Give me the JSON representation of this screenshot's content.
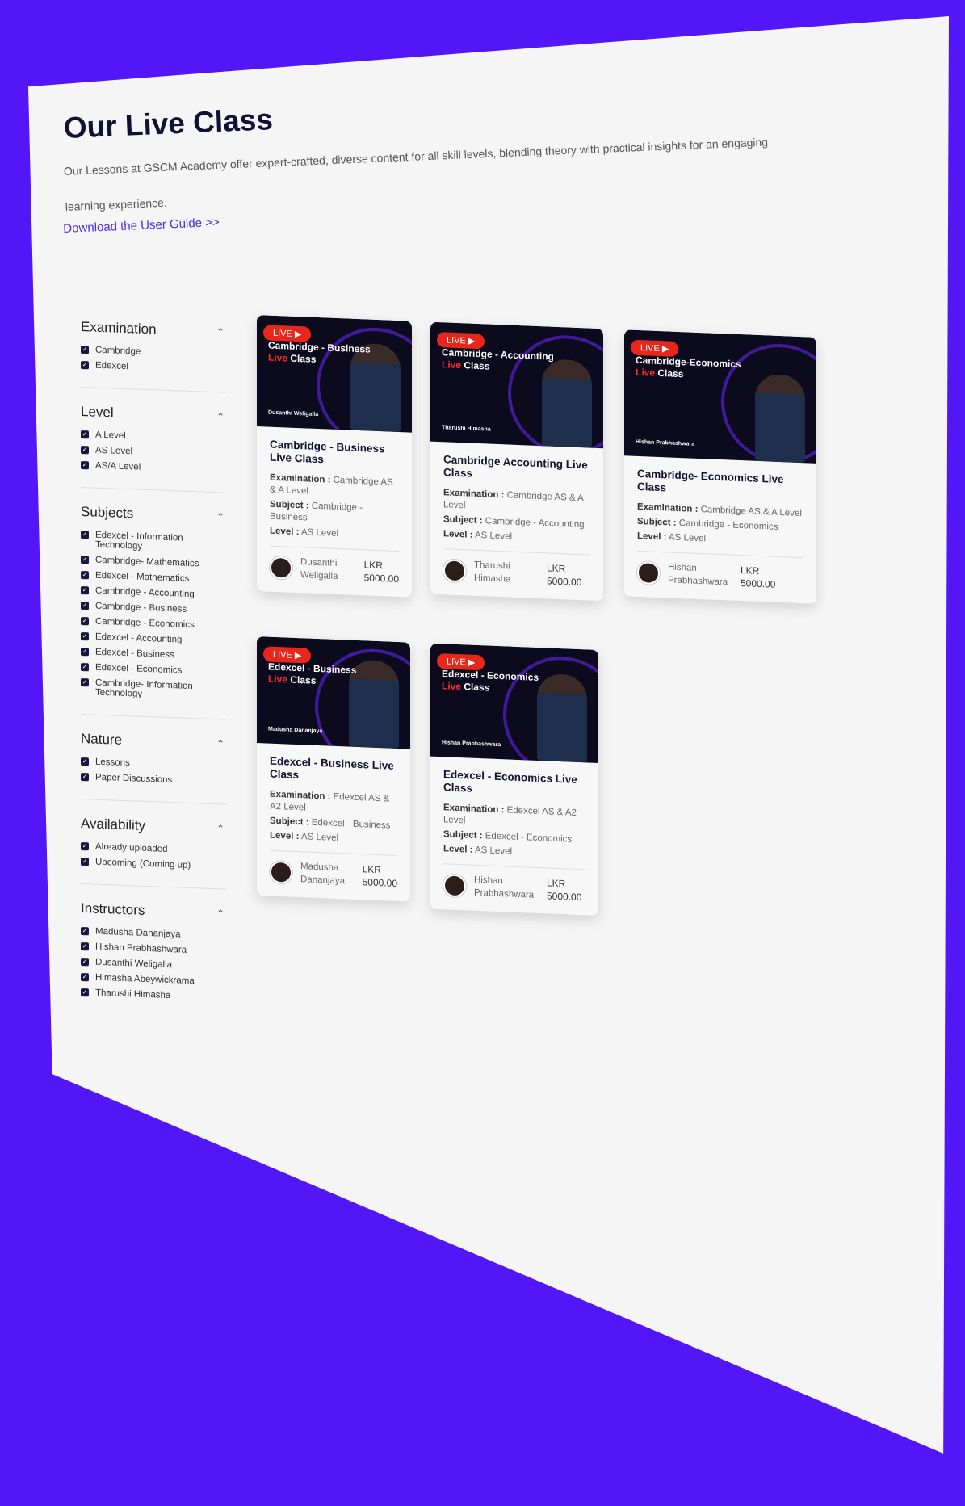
{
  "header": {
    "title": "Our Live Class",
    "intro": "Our Lessons at GSCM Academy offer expert-crafted, diverse content for all skill levels, blending theory with practical insights for an engaging learning experience.",
    "guide_link": "Download the User Guide >>"
  },
  "filters": [
    {
      "title": "Examination",
      "options": [
        "Cambridge",
        "Edexcel"
      ]
    },
    {
      "title": "Level",
      "options": [
        "A Level",
        "AS Level",
        "AS/A Level"
      ]
    },
    {
      "title": "Subjects",
      "options": [
        "Edexcel - Information Technology",
        "Cambridge- Mathematics",
        "Edexcel - Mathematics",
        "Cambridge - Accounting",
        "Cambridge - Business",
        "Cambridge - Economics",
        "Edexcel - Accounting",
        "Edexcel - Business",
        "Edexcel - Economics",
        "Cambridge- Information Technology"
      ]
    },
    {
      "title": "Nature",
      "options": [
        "Lessons",
        "Paper Discussions"
      ]
    },
    {
      "title": "Availability",
      "options": [
        "Already uploaded",
        "Upcoming (Coming up)"
      ]
    },
    {
      "title": "Instructors",
      "options": [
        "Madusha Dananjaya",
        "Hishan Prabhashwara",
        "Dusanthi Weligalla",
        "Himasha Abeywickrama",
        "Tharushi Himasha"
      ]
    }
  ],
  "labels": {
    "live": "LIVE",
    "examination": "Examination :",
    "subject": "Subject :",
    "level": "Level :",
    "currency": "LKR"
  },
  "cards": [
    {
      "thumb_line1": "Cambridge - Business",
      "thumb_red": "Live",
      "thumb_line2": "Class",
      "thumb_name": "Dusanthi Weligalla",
      "title": "Cambridge - Business Live Class",
      "examination": "Cambridge AS & A Level",
      "subject": "Cambridge - Business",
      "level": "AS Level",
      "instructor": "Dusanthi Weligalla",
      "price": "5000.00"
    },
    {
      "thumb_line1": "Cambridge - Accounting",
      "thumb_red": "Live",
      "thumb_line2": "Class",
      "thumb_name": "Tharushi Himasha",
      "title": "Cambridge Accounting Live Class",
      "examination": "Cambridge AS & A Level",
      "subject": "Cambridge - Accounting",
      "level": "AS Level",
      "instructor": "Tharushi Himasha",
      "price": "5000.00"
    },
    {
      "thumb_line1": "Cambridge-Economics",
      "thumb_red": "Live",
      "thumb_line2": "Class",
      "thumb_name": "Hishan Prabhashwara",
      "title": "Cambridge- Economics Live Class",
      "examination": "Cambridge AS & A Level",
      "subject": "Cambridge - Economics",
      "level": "AS Level",
      "instructor": "Hishan Prabhashwara",
      "price": "5000.00"
    },
    {
      "thumb_line1": "Edexcel - Business",
      "thumb_red": "Live",
      "thumb_line2": "Class",
      "thumb_name": "Madusha Dananjaya",
      "title": "Edexcel - Business Live Class",
      "examination": "Edexcel AS & A2 Level",
      "subject": "Edexcel - Business",
      "level": "AS Level",
      "instructor": "Madusha Dananjaya",
      "price": "5000.00"
    },
    {
      "thumb_line1": "Edexcel - Economics",
      "thumb_red": "Live",
      "thumb_line2": "Class",
      "thumb_name": "Hishan Prabhashwara",
      "title": "Edexcel - Economics Live Class",
      "examination": "Edexcel AS & A2 Level",
      "subject": "Edexcel - Economics",
      "level": "AS Level",
      "instructor": "Hishan Prabhashwara",
      "price": "5000.00"
    }
  ],
  "colors": {
    "background": "#5317f7",
    "accent": "#4a2de6",
    "live_badge": "#e8271c",
    "dark": "#111133"
  }
}
